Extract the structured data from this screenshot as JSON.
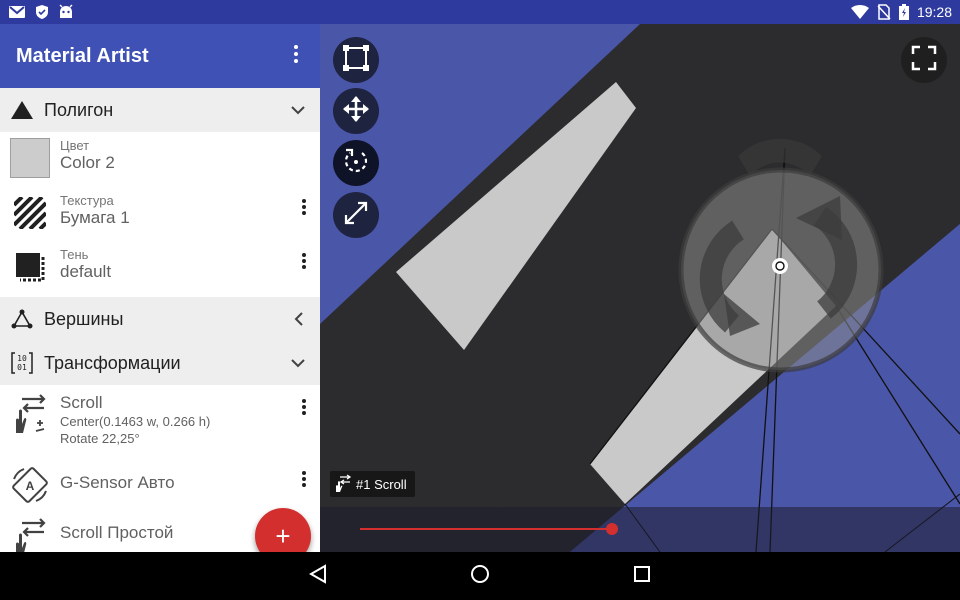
{
  "status": {
    "time": "19:28",
    "notification_icons": [
      "mail-icon",
      "shield-icon",
      "android-icon"
    ],
    "system_icons": [
      "wifi-icon",
      "no-sim-icon",
      "battery-charging-icon"
    ]
  },
  "appbar": {
    "title": "Material Artist",
    "more_icon": "more-vert-icon"
  },
  "sections": {
    "polygon": {
      "label": "Полигон",
      "icon": "triangle-icon",
      "state": "expanded"
    },
    "vertices": {
      "label": "Вершины",
      "icon": "vertices-icon",
      "state": "collapsed"
    },
    "transforms": {
      "label": "Трансформации",
      "icon": "binary-matrix-icon",
      "state": "expanded"
    }
  },
  "polygon_props": [
    {
      "caption": "Цвет",
      "value": "Color 2",
      "icon": "color-swatch-icon",
      "swatch_color": "#cccccc"
    },
    {
      "caption": "Текстура",
      "value": "Бумага 1",
      "icon": "hatch-texture-icon"
    },
    {
      "caption": "Тень",
      "value": "default",
      "icon": "shadow-icon"
    }
  ],
  "transform_items": [
    {
      "title": "Scroll",
      "line1": "Center(0.1463 w, 0.266 h)",
      "line2": "Rotate 22,25°",
      "icon": "scroll-gesture-icon"
    },
    {
      "title": "G-Sensor Авто",
      "icon": "auto-rotate-icon"
    },
    {
      "title": "Scroll Простой",
      "icon": "scroll-gesture-icon"
    }
  ],
  "fab": {
    "label": "+"
  },
  "canvas": {
    "tools": [
      "select-bounds-icon",
      "move-icon",
      "rotate-icon",
      "resize-icon"
    ],
    "active_tool": "rotate-icon",
    "fullscreen_icon": "fullscreen-icon",
    "layer_label": "#1 Scroll",
    "seek_progress": 0.44
  },
  "colors": {
    "primary": "#3f51b5",
    "primary_dark": "#2f3a9e",
    "accent": "#d32f2f",
    "canvas_blue": "#4a56a8",
    "canvas_dark": "#2a2a2a"
  },
  "navbar": {
    "icons": [
      "back-icon",
      "home-icon",
      "recents-icon"
    ]
  }
}
